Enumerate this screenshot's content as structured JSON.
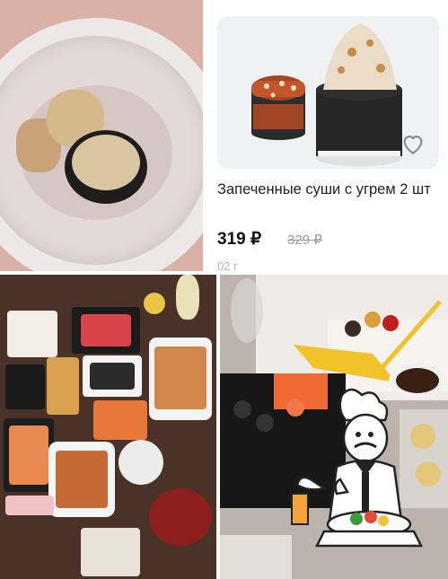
{
  "product": {
    "title": "Запеченные суши с угрем 2 шт",
    "price": "319 ₽",
    "old_price": "329 ₽",
    "cut_off_text": "02 г"
  },
  "icons": {
    "favorite": "heart-outline-icon",
    "chef": "chef-holding-plate-illustration"
  },
  "colors": {
    "price_text": "#111111",
    "old_price_text": "#9a9a9a",
    "card_image_bg": "#eff1f3"
  }
}
